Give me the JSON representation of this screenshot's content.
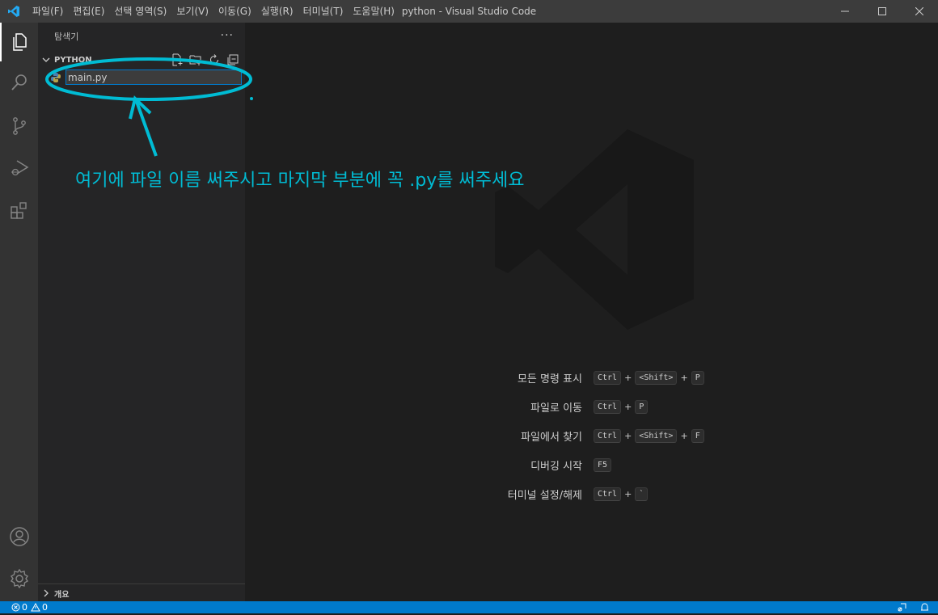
{
  "window": {
    "title": "python - Visual Studio Code"
  },
  "menu": [
    "파일(F)",
    "편집(E)",
    "선택 영역(S)",
    "보기(V)",
    "이동(G)",
    "실행(R)",
    "터미널(T)",
    "도움말(H)"
  ],
  "activity_bar": {
    "icons": [
      "explorer-icon",
      "search-icon",
      "source-control-icon",
      "run-debug-icon",
      "extensions-icon",
      "accounts-icon",
      "manage-gear-icon"
    ],
    "active": "explorer-icon"
  },
  "sidebar": {
    "title": "탐색기",
    "folder_name": "PYTHON",
    "new_file_name": "main.py",
    "outline_label": "개요"
  },
  "editor": {
    "shortcuts": [
      {
        "label": "모든 명령 표시",
        "keys": [
          "Ctrl",
          "<Shift>",
          "P"
        ]
      },
      {
        "label": "파일로 이동",
        "keys": [
          "Ctrl",
          "P"
        ]
      },
      {
        "label": "파일에서 찾기",
        "keys": [
          "Ctrl",
          "<Shift>",
          "F"
        ]
      },
      {
        "label": "디버깅 시작",
        "keys": [
          "F5"
        ]
      },
      {
        "label": "터미널 설정/해제",
        "keys": [
          "Ctrl",
          "`"
        ]
      }
    ]
  },
  "annotation": {
    "text": "여기에 파일 이름 써주시고 마지막 부분에 꼭 .py를 써주세요",
    "color": "#00bcd4"
  },
  "statusbar": {
    "errors": "0",
    "warnings": "0",
    "color": "#007acc"
  }
}
